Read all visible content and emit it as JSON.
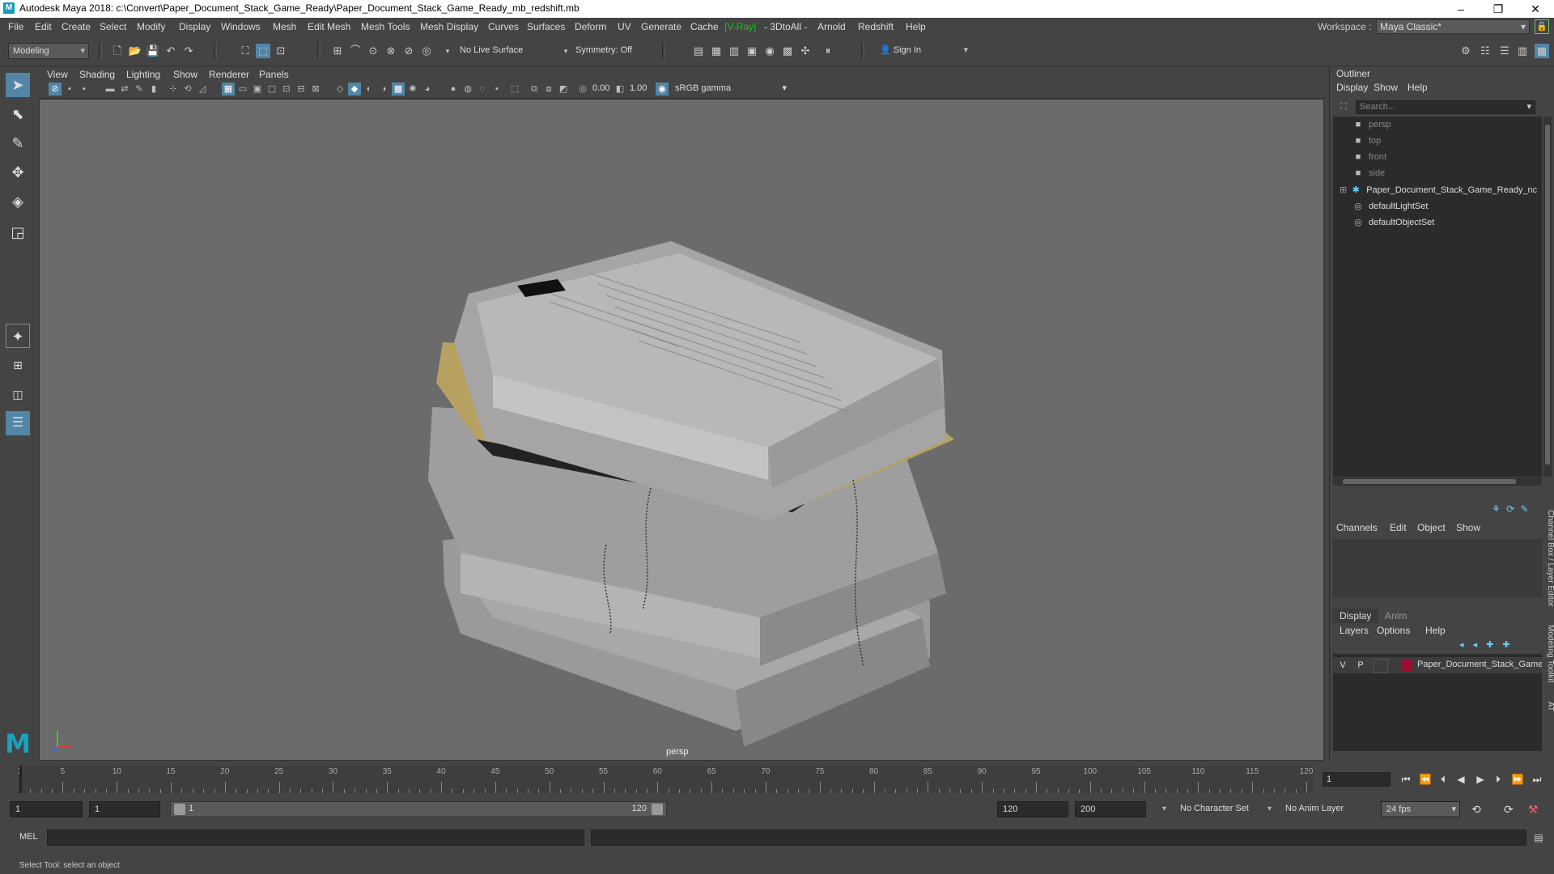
{
  "window": {
    "title": "Autodesk Maya 2018: c:\\Convert\\Paper_Document_Stack_Game_Ready\\Paper_Document_Stack_Game_Ready_mb_redshift.mb",
    "logo": "M",
    "minimize": "–",
    "maximize": "❐",
    "close": "✕"
  },
  "menubar": {
    "items": [
      "File",
      "Edit",
      "Create",
      "Select",
      "Modify",
      "Display",
      "Windows",
      "Mesh",
      "Edit Mesh",
      "Mesh Tools",
      "Mesh Display",
      "Curves",
      "Surfaces",
      "Deform",
      "UV",
      "Generate",
      "Cache",
      "[V-Ray]",
      "- 3DtoAll -",
      "Arnold",
      "Redshift",
      "Help"
    ],
    "workspace_label": "Workspace :",
    "workspace_value": "Maya Classic*"
  },
  "statusline": {
    "menuset": "Modeling",
    "live_surface": "No Live Surface",
    "symmetry": "Symmetry: Off",
    "sign_in": "Sign In"
  },
  "viewport": {
    "menus": [
      "View",
      "Shading",
      "Lighting",
      "Show",
      "Renderer",
      "Panels"
    ],
    "exposure": "0.00",
    "gamma": "1.00",
    "color_space": "sRGB gamma",
    "camera": "persp"
  },
  "outliner": {
    "title": "Outliner",
    "menus": [
      "Display",
      "Show",
      "Help"
    ],
    "search_placeholder": "Search...",
    "items": [
      {
        "label": "persp",
        "icon": "camera-icon"
      },
      {
        "label": "top",
        "icon": "camera-icon"
      },
      {
        "label": "front",
        "icon": "camera-icon"
      },
      {
        "label": "side",
        "icon": "camera-icon"
      },
      {
        "label": "Paper_Document_Stack_Game_Ready_nc",
        "icon": "transform-icon"
      },
      {
        "label": "defaultLightSet",
        "icon": "set-icon"
      },
      {
        "label": "defaultObjectSet",
        "icon": "set-icon"
      }
    ]
  },
  "channelbox": {
    "menus": [
      "Channels",
      "Edit",
      "Object",
      "Show"
    ],
    "side_tab": "Channel Box / Layer Editor",
    "side_tab2": "Modeling Toolkit",
    "side_tab3": "AT"
  },
  "layers": {
    "tabs": [
      "Display",
      "Anim"
    ],
    "menus": [
      "Layers",
      "Options",
      "Help"
    ],
    "row": {
      "v": "V",
      "p": "P",
      "name": "Paper_Document_Stack_Game_",
      "color": "#9b1030"
    }
  },
  "timeslider": {
    "ticks": [
      1,
      5,
      10,
      15,
      20,
      25,
      30,
      35,
      40,
      45,
      50,
      55,
      60,
      65,
      70,
      75,
      80,
      85,
      90,
      95,
      100,
      105,
      110,
      115,
      120
    ],
    "current_frame": "1"
  },
  "rangeslider": {
    "start": "1",
    "playback_start": "1",
    "range_start_label": "1",
    "range_end_label": "120",
    "playback_end": "120",
    "end": "200",
    "character_set": "No Character Set",
    "anim_layer": "No Anim Layer",
    "fps": "24 fps"
  },
  "cmdline": {
    "label": "MEL"
  },
  "helpline": {
    "text": "Select Tool: select an object"
  }
}
